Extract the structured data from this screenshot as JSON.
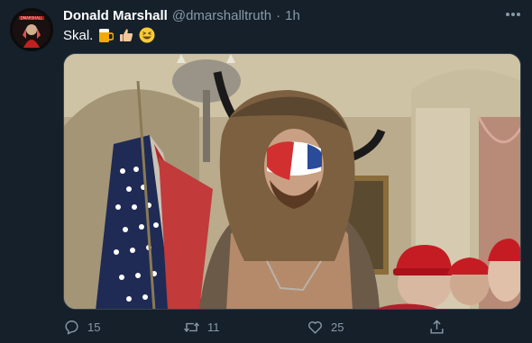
{
  "tweet": {
    "author_name": "Donald Marshall",
    "author_handle": "@dmarshalltruth",
    "separator": "·",
    "timestamp": "1h",
    "text": "Skal.",
    "emojis": [
      "beer-mug-emoji",
      "thumbs-up-emoji",
      "grinning-squinting-face-emoji"
    ],
    "avatar_text": "DMARSHALL",
    "media_description_icons": [
      "flag",
      "horned-fur-hat",
      "red-caps"
    ]
  },
  "actions": {
    "replies": "15",
    "retweets": "11",
    "likes": "25"
  },
  "colors": {
    "background": "#15202b",
    "secondary_text": "#8899a6",
    "border": "#38444d"
  }
}
